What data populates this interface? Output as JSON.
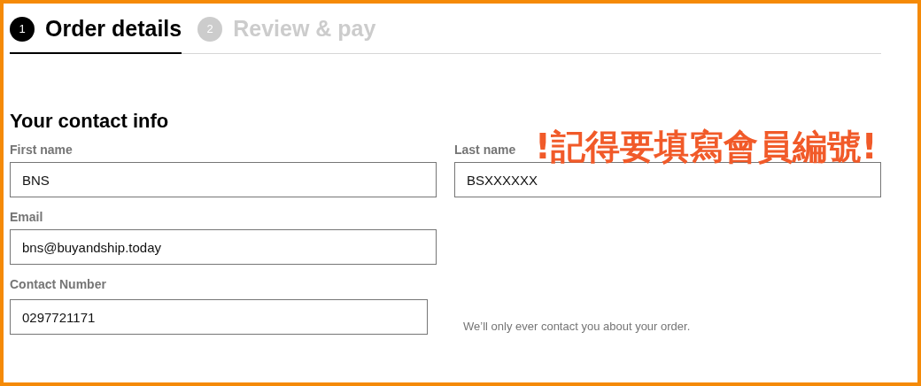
{
  "steps": [
    {
      "number": "1",
      "label": "Order details",
      "selected": true
    },
    {
      "number": "2",
      "label": "Review & pay",
      "selected": false
    }
  ],
  "section_title": "Your contact info",
  "fields": [
    {
      "label": "First name",
      "value": "BNS"
    },
    {
      "label": "Last name",
      "value": "BSXXXXXX"
    },
    {
      "label": "Email",
      "value": "bns@buyandship.today"
    },
    {
      "label": "Contact Number",
      "value": "0297721171"
    }
  ],
  "hint": "We’ll only ever contact you about your order.",
  "annotation": "!記得要填寫會員編號!"
}
